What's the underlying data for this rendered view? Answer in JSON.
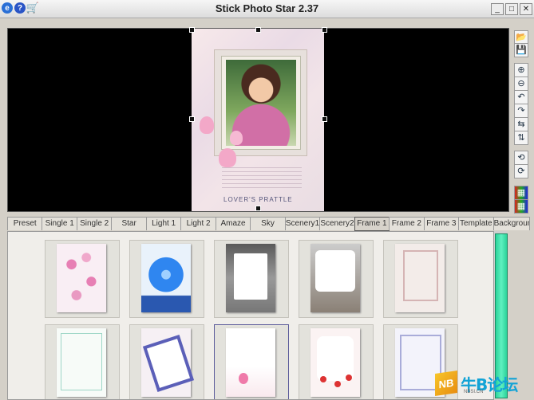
{
  "window": {
    "title": "Stick Photo Star 2.37",
    "left_icons": [
      "ie-icon",
      "help-icon",
      "cart-icon"
    ],
    "controls": {
      "minimize": "_",
      "maximize": "□",
      "close": "✕"
    }
  },
  "preview": {
    "photo_caption": "LOVER'S PRATTLE"
  },
  "right_toolbar": [
    {
      "name": "open-folder-icon",
      "glyph": "📂"
    },
    {
      "name": "save-icon",
      "glyph": "💾"
    },
    {
      "name": "zoom-in-icon",
      "glyph": "⊕"
    },
    {
      "name": "zoom-out-icon",
      "glyph": "⊖"
    },
    {
      "name": "rotate-left-icon",
      "glyph": "↶"
    },
    {
      "name": "rotate-right-icon",
      "glyph": "↷"
    },
    {
      "name": "flip-horizontal-icon",
      "glyph": "⇆"
    },
    {
      "name": "flip-vertical-icon",
      "glyph": "⇅"
    },
    {
      "name": "crop-icon",
      "glyph": "⟲"
    },
    {
      "name": "reset-icon",
      "glyph": "⟳"
    },
    {
      "name": "color-adjust-icon",
      "glyph": "▦"
    },
    {
      "name": "color-balance-icon",
      "glyph": "▦"
    }
  ],
  "tabs": {
    "active": "Frame 1",
    "items": [
      "Preset",
      "Single 1",
      "Single 2",
      "Star",
      "Light 1",
      "Light 2",
      "Amaze",
      "Sky",
      "Scenery1",
      "Scenery2",
      "Frame 1",
      "Frame 2",
      "Frame 3",
      "Template",
      "Background"
    ]
  },
  "gallery": {
    "selected_index": 7,
    "thumbnails": [
      "pink-flowers",
      "blue-flower",
      "gray-frame",
      "white-vignette",
      "pink-border",
      "green-border",
      "tilted-frame",
      "tulip-frame",
      "red-floral",
      "lilac-frame"
    ]
  },
  "watermark": {
    "badge": "NB",
    "text": "牛B论坛",
    "sub": "NBSI.CN"
  },
  "colors": {
    "scroll_thumb": "#2bd39a",
    "active_tab_border": "#555555"
  }
}
